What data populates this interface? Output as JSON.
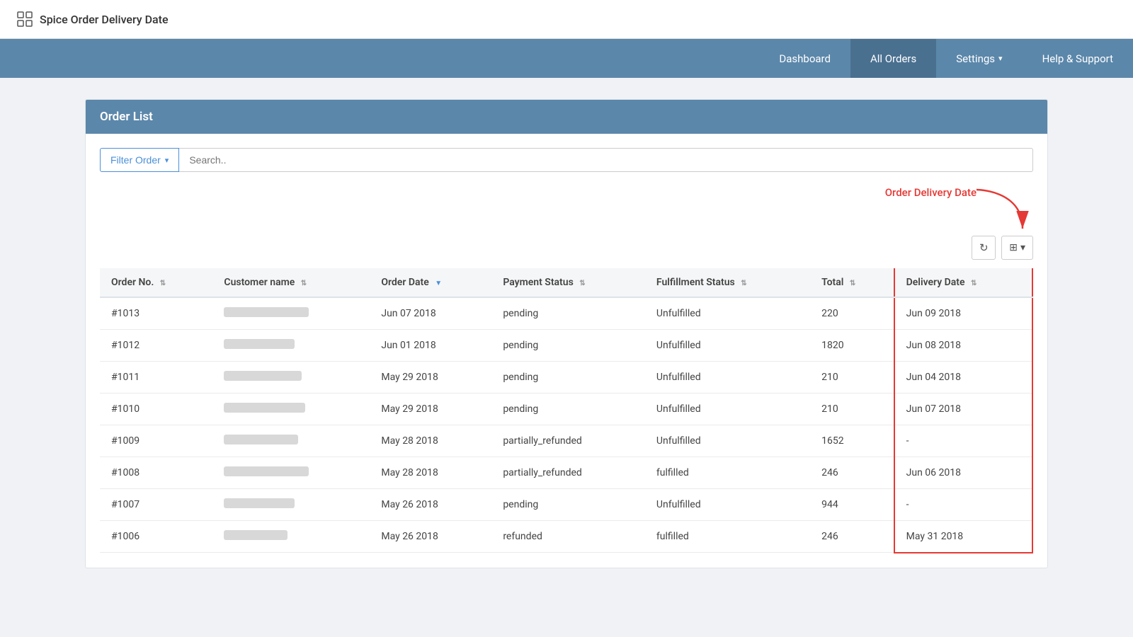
{
  "app": {
    "title": "Spice Order Delivery Date"
  },
  "nav": {
    "items": [
      {
        "id": "dashboard",
        "label": "Dashboard",
        "active": false
      },
      {
        "id": "all-orders",
        "label": "All Orders",
        "active": true
      },
      {
        "id": "settings",
        "label": "Settings",
        "active": false,
        "hasChevron": true
      },
      {
        "id": "help-support",
        "label": "Help & Support",
        "active": false
      }
    ]
  },
  "orderList": {
    "title": "Order List",
    "filter": {
      "label": "Filter Order"
    },
    "search": {
      "placeholder": "Search.."
    },
    "annotation": {
      "label": "Order Delivery Date"
    },
    "columns": [
      {
        "id": "order-no",
        "label": "Order No.",
        "sortable": true
      },
      {
        "id": "customer-name",
        "label": "Customer name",
        "sortable": true
      },
      {
        "id": "order-date",
        "label": "Order Date",
        "sortable": true,
        "sorted": true
      },
      {
        "id": "payment-status",
        "label": "Payment Status",
        "sortable": true
      },
      {
        "id": "fulfillment-status",
        "label": "Fulfillment Status",
        "sortable": true
      },
      {
        "id": "total",
        "label": "Total",
        "sortable": true
      },
      {
        "id": "delivery-date",
        "label": "Delivery Date",
        "sortable": true,
        "highlighted": true
      }
    ],
    "rows": [
      {
        "orderNo": "#1013",
        "customerWidth": 120,
        "orderDate": "Jun 07 2018",
        "paymentStatus": "pending",
        "fulfillmentStatus": "Unfulfilled",
        "total": "220",
        "deliveryDate": "Jun 09 2018"
      },
      {
        "orderNo": "#1012",
        "customerWidth": 100,
        "orderDate": "Jun 01 2018",
        "paymentStatus": "pending",
        "fulfillmentStatus": "Unfulfilled",
        "total": "1820",
        "deliveryDate": "Jun 08 2018"
      },
      {
        "orderNo": "#1011",
        "customerWidth": 110,
        "orderDate": "May 29 2018",
        "paymentStatus": "pending",
        "fulfillmentStatus": "Unfulfilled",
        "total": "210",
        "deliveryDate": "Jun 04 2018"
      },
      {
        "orderNo": "#1010",
        "customerWidth": 115,
        "orderDate": "May 29 2018",
        "paymentStatus": "pending",
        "fulfillmentStatus": "Unfulfilled",
        "total": "210",
        "deliveryDate": "Jun 07 2018"
      },
      {
        "orderNo": "#1009",
        "customerWidth": 105,
        "orderDate": "May 28 2018",
        "paymentStatus": "partially_refunded",
        "fulfillmentStatus": "Unfulfilled",
        "total": "1652",
        "deliveryDate": "-"
      },
      {
        "orderNo": "#1008",
        "customerWidth": 120,
        "orderDate": "May 28 2018",
        "paymentStatus": "partially_refunded",
        "fulfillmentStatus": "fulfilled",
        "total": "246",
        "deliveryDate": "Jun 06 2018"
      },
      {
        "orderNo": "#1007",
        "customerWidth": 100,
        "orderDate": "May 26 2018",
        "paymentStatus": "pending",
        "fulfillmentStatus": "Unfulfilled",
        "total": "944",
        "deliveryDate": "-"
      },
      {
        "orderNo": "#1006",
        "customerWidth": 90,
        "orderDate": "May 26 2018",
        "paymentStatus": "refunded",
        "fulfillmentStatus": "fulfilled",
        "total": "246",
        "deliveryDate": "May 31 2018"
      }
    ],
    "toolbar": {
      "refresh": "↻",
      "grid": "⊞"
    }
  }
}
